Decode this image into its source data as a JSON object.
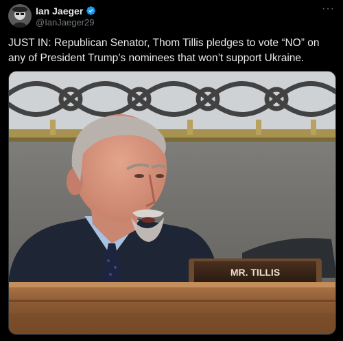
{
  "post": {
    "author": {
      "display_name": "Ian Jaeger",
      "handle": "@IanJaeger29",
      "verified": true,
      "avatar_icon": "avatar-icon"
    },
    "more_icon": "more-icon",
    "text": "JUST IN: Republican Senator, Thom Tillis pledges to vote “NO” on any of President Trump’s nominees that won’t support Ukraine.",
    "media": {
      "nameplate": "MR. TILLIS"
    }
  },
  "colors": {
    "background": "#000000",
    "text": "#e7e9ea",
    "secondary_text": "#71767b",
    "verified_badge": "#1d9bf0"
  }
}
